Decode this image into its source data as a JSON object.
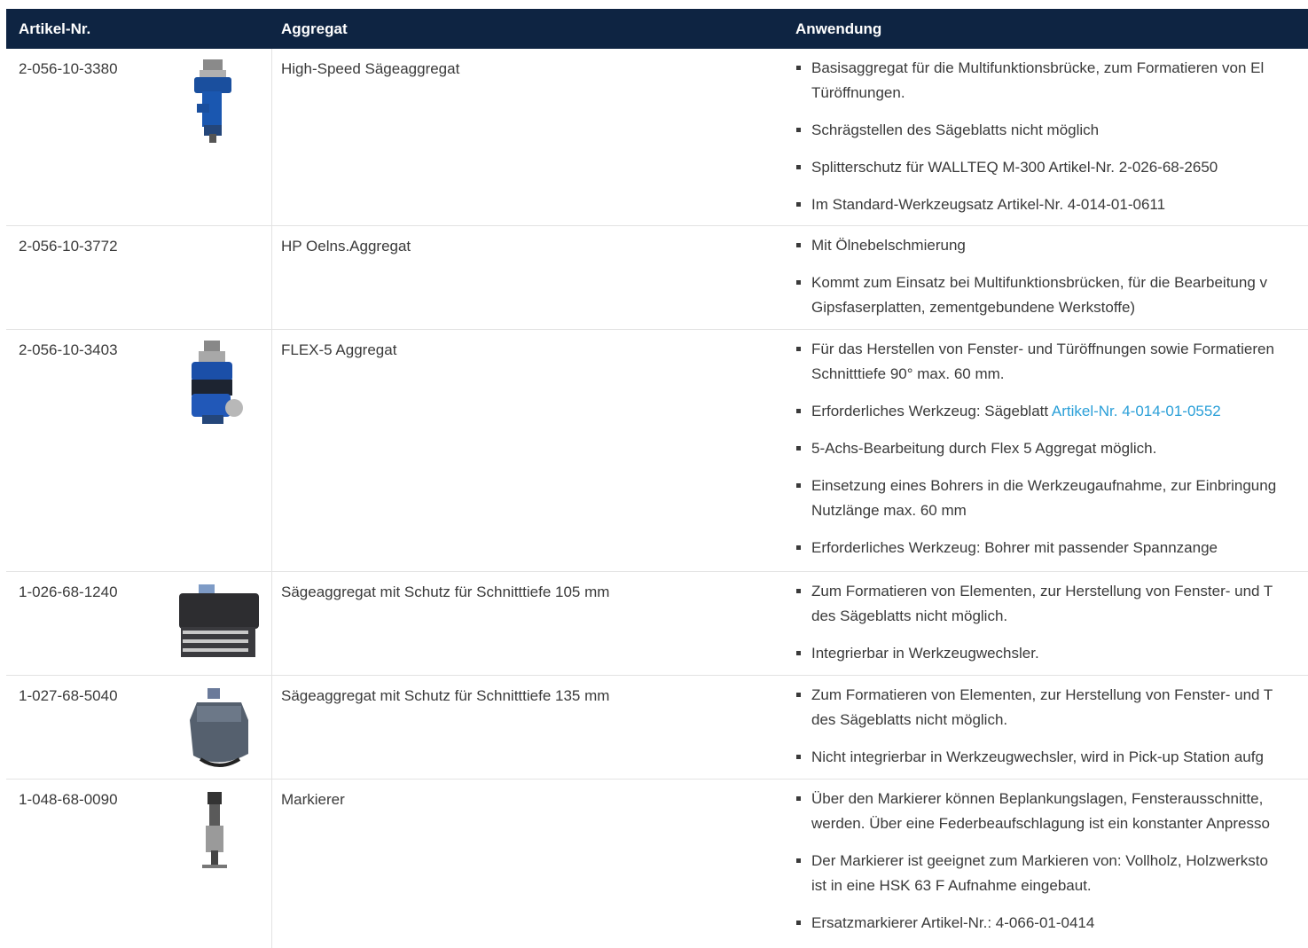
{
  "header": {
    "col1": "Artikel-Nr.",
    "col2": "Aggregat",
    "col3": "Anwendung"
  },
  "rows": [
    {
      "artikel": "2-056-10-3380",
      "aggregat": "High-Speed Sägeaggregat",
      "image_icon": "high-speed-saw-unit-icon",
      "bullets": [
        {
          "lines": [
            "Basisaggregat für die Multifunktionsbrücke, zum Formatieren von El",
            "Türöffnungen."
          ]
        },
        {
          "lines": [
            "Schrägstellen des Sägeblatts nicht möglich"
          ]
        },
        {
          "lines": [
            "Splitterschutz für WALLTEQ M-300 Artikel-Nr. 2-026-68-2650"
          ]
        },
        {
          "lines": [
            "Im Standard-Werkzeugsatz Artikel-Nr. 4-014-01-0611"
          ]
        }
      ]
    },
    {
      "artikel": "2-056-10-3772",
      "aggregat": "HP Oelns.Aggregat",
      "bullets": [
        {
          "lines": [
            "Mit Ölnebelschmierung"
          ]
        },
        {
          "lines": [
            "Kommt zum Einsatz bei Multifunktionsbrücken, für die Bearbeitung v",
            "Gipsfaserplatten, zementgebundene Werkstoffe)"
          ]
        }
      ]
    },
    {
      "artikel": "2-056-10-3403",
      "aggregat": "FLEX-5 Aggregat",
      "image_icon": "flex5-unit-icon",
      "bullets": [
        {
          "lines": [
            "Für das Herstellen von Fenster- und Türöffnungen sowie Formatieren",
            "Schnitttiefe 90° max. 60 mm."
          ]
        },
        {
          "text": "Erforderliches Werkzeug: Sägeblatt ",
          "link": "Artikel-Nr. 4-014-01-0552"
        },
        {
          "lines": [
            "5-Achs-Bearbeitung durch Flex 5 Aggregat möglich."
          ]
        },
        {
          "lines": [
            "Einsetzung eines Bohrers in die Werkzeugaufnahme, zur Einbringung",
            "Nutzlänge max. 60 mm"
          ]
        },
        {
          "lines": [
            "Erforderliches Werkzeug: Bohrer mit passender Spannzange"
          ]
        }
      ]
    },
    {
      "artikel": "1-026-68-1240",
      "aggregat": "Sägeaggregat mit Schutz für Schnitttiefe 105 mm",
      "image_icon": "saw-unit-105-icon",
      "bullets": [
        {
          "lines": [
            "Zum Formatieren von Elementen, zur Herstellung von Fenster- und T",
            "des Sägeblatts nicht möglich."
          ]
        },
        {
          "lines": [
            "Integrierbar in Werkzeugwechsler."
          ]
        }
      ]
    },
    {
      "artikel": "1-027-68-5040",
      "aggregat": "Sägeaggregat mit Schutz für Schnitttiefe 135 mm",
      "image_icon": "saw-unit-135-icon",
      "bullets": [
        {
          "lines": [
            "Zum Formatieren von Elementen, zur Herstellung von Fenster- und T",
            "des Sägeblatts nicht möglich."
          ]
        },
        {
          "lines": [
            "Nicht integrierbar in Werkzeugwechsler, wird in Pick-up Station aufg"
          ]
        }
      ]
    },
    {
      "artikel": "1-048-68-0090",
      "aggregat": "Markierer",
      "image_icon": "marker-unit-icon",
      "bullets": [
        {
          "lines": [
            "Über den Markierer können Beplankungslagen, Fensterausschnitte,",
            "werden. Über eine Federbeaufschlagung ist ein konstanter Anpresso"
          ]
        },
        {
          "lines": [
            "Der Markierer ist geeignet zum Markieren von: Vollholz, Holzwerksto",
            "ist in eine HSK 63 F Aufnahme eingebaut."
          ]
        },
        {
          "lines": [
            "Ersatzmarkierer Artikel-Nr.: 4-066-01-0414"
          ]
        }
      ]
    }
  ]
}
